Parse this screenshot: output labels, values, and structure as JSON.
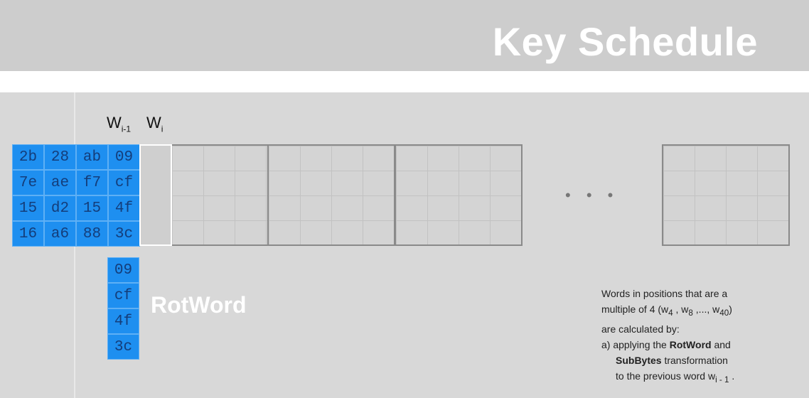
{
  "title": "Key Schedule",
  "labels": {
    "w_prev_main": "W",
    "w_prev_sub": "i-1",
    "w_cur_main": "W",
    "w_cur_sub": "i",
    "rotword": "RotWord",
    "ellipsis": "• • •"
  },
  "key_matrix": [
    [
      "2b",
      "28",
      "ab",
      "09"
    ],
    [
      "7e",
      "ae",
      "f7",
      "cf"
    ],
    [
      "15",
      "d2",
      "15",
      "4f"
    ],
    [
      "16",
      "a6",
      "88",
      "3c"
    ]
  ],
  "rotword_column": [
    "09",
    "cf",
    "4f",
    "3c"
  ],
  "note": {
    "line1": "Words in positions that are a",
    "line2": "multiple of 4 (w",
    "line2_sub1": "4",
    "line2_mid": " , w",
    "line2_sub2": "8",
    "line2_end": " ,..., w",
    "line2_sub3": "40",
    "line2_close": ")",
    "line3": "are calculated by:",
    "line4_pre": "a) applying the ",
    "line4_bold": "RotWord",
    "line4_post": " and",
    "line5_bold": "SubBytes",
    "line5_post": " transformation",
    "line6_pre": "to the previous word w",
    "line6_sub": "i - 1",
    "line6_post": " ."
  },
  "colors": {
    "cell_blue": "#1e8ff0",
    "cell_text": "#143d7a",
    "title_text": "#ffffff"
  }
}
